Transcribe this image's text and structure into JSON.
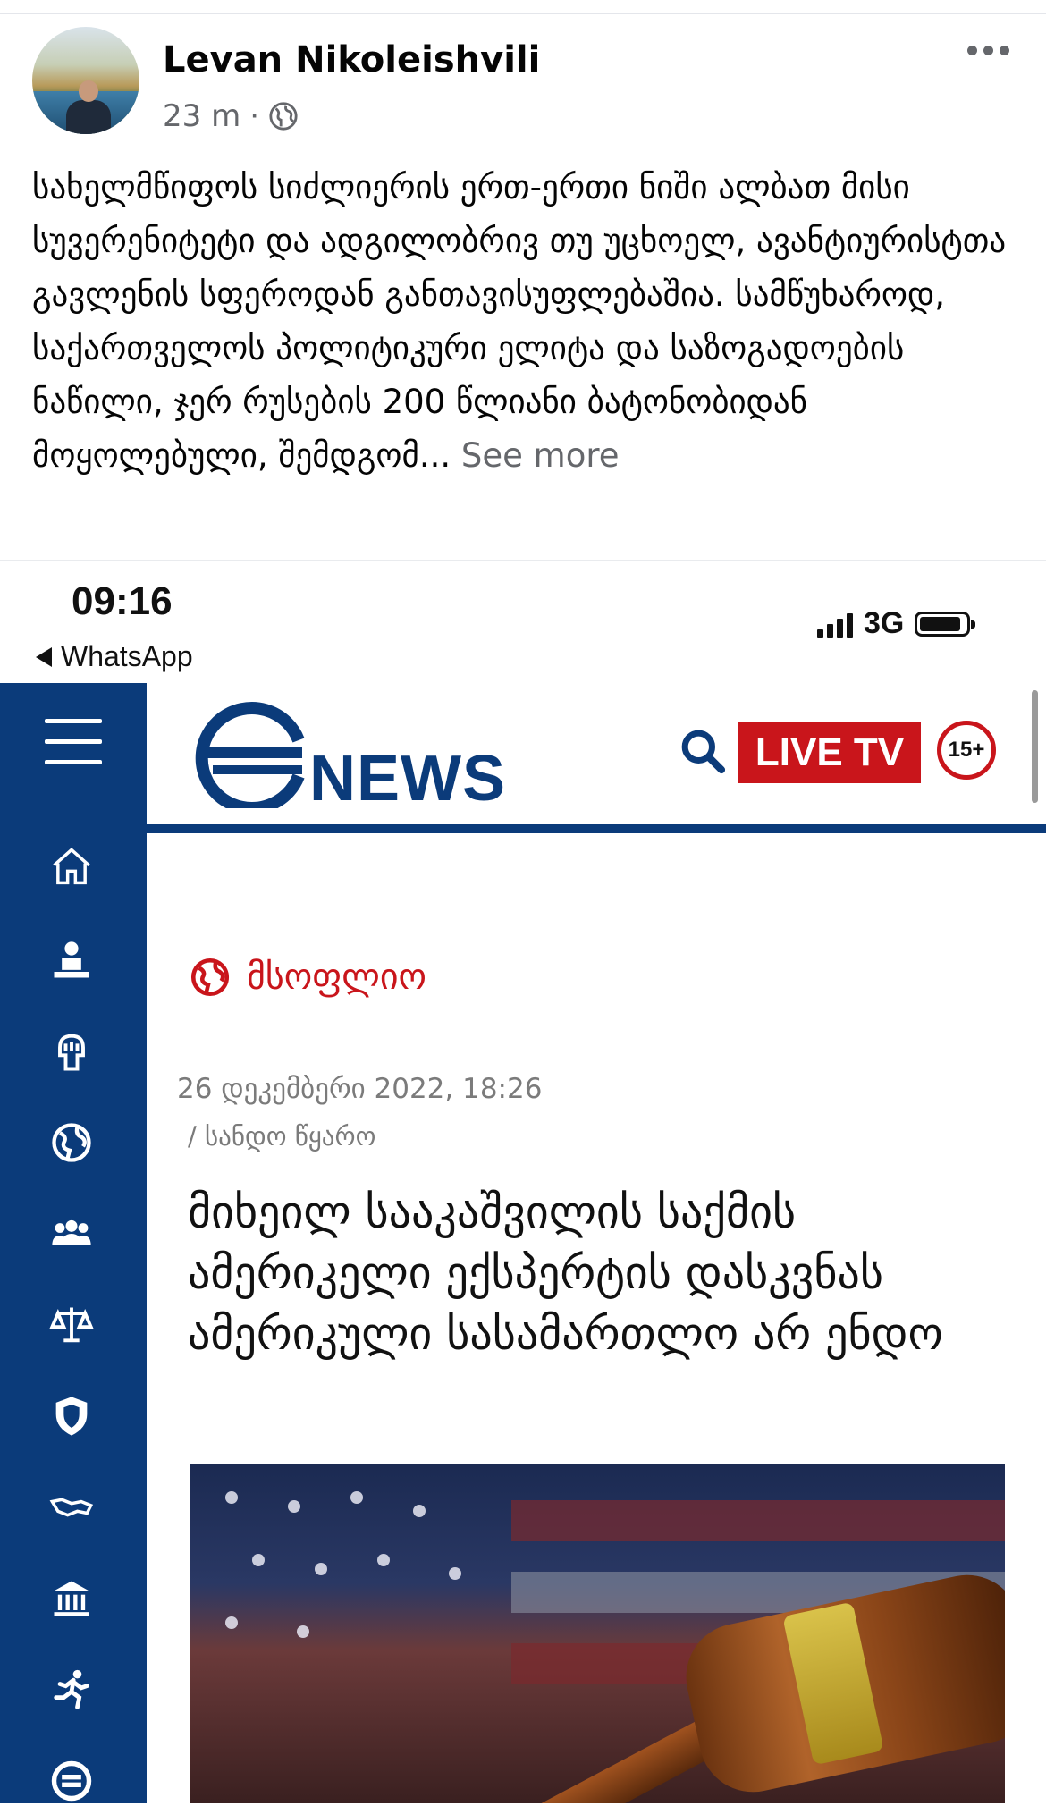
{
  "post": {
    "author": "Levan Nikoleishvili",
    "time": "23 m",
    "separator": "·",
    "text": "სახელმწიფოს სიძლიერის ერთ-ერთი ნიში ალბათ მისი სუვერენიტეტი და ადგილობრივ თუ უცხოელ, ავანტიურისტთა გავლენის სფეროდან განთავისუფლებაშია. სამწუხაროდ, საქართველოს პოლიტიკური ელიტა და საზოგადოების ნაწილი, ჯერ რუსების 200 წლიანი ბატონობიდან მოყოლებული, შემდგომ...",
    "see_more": "See more"
  },
  "phone_status": {
    "time": "09:16",
    "back_app": "WhatsApp",
    "network": "3G"
  },
  "site": {
    "logo_text": "NEWS",
    "live_label": "LIVE TV",
    "age_rating": "15+",
    "accent_color": "#0b3b7a",
    "live_color": "#c9151b"
  },
  "sidebar": {
    "icons": [
      "home-icon",
      "person-podium-icon",
      "fist-icon",
      "globe-icon",
      "group-icon",
      "scales-icon",
      "shield-icon",
      "georgia-map-icon",
      "museum-icon",
      "running-icon",
      "channel-logo-icon"
    ]
  },
  "article": {
    "category": "მსოფლიო",
    "date": "26 დეკემბერი 2022, 18:26",
    "source": "/ სანდო წყარო",
    "headline": "მიხეილ სააკაშვილის საქმის ამერიკელი ექსპერტის დასკვნას ამერიკული სასამართლო არ ენდო"
  }
}
